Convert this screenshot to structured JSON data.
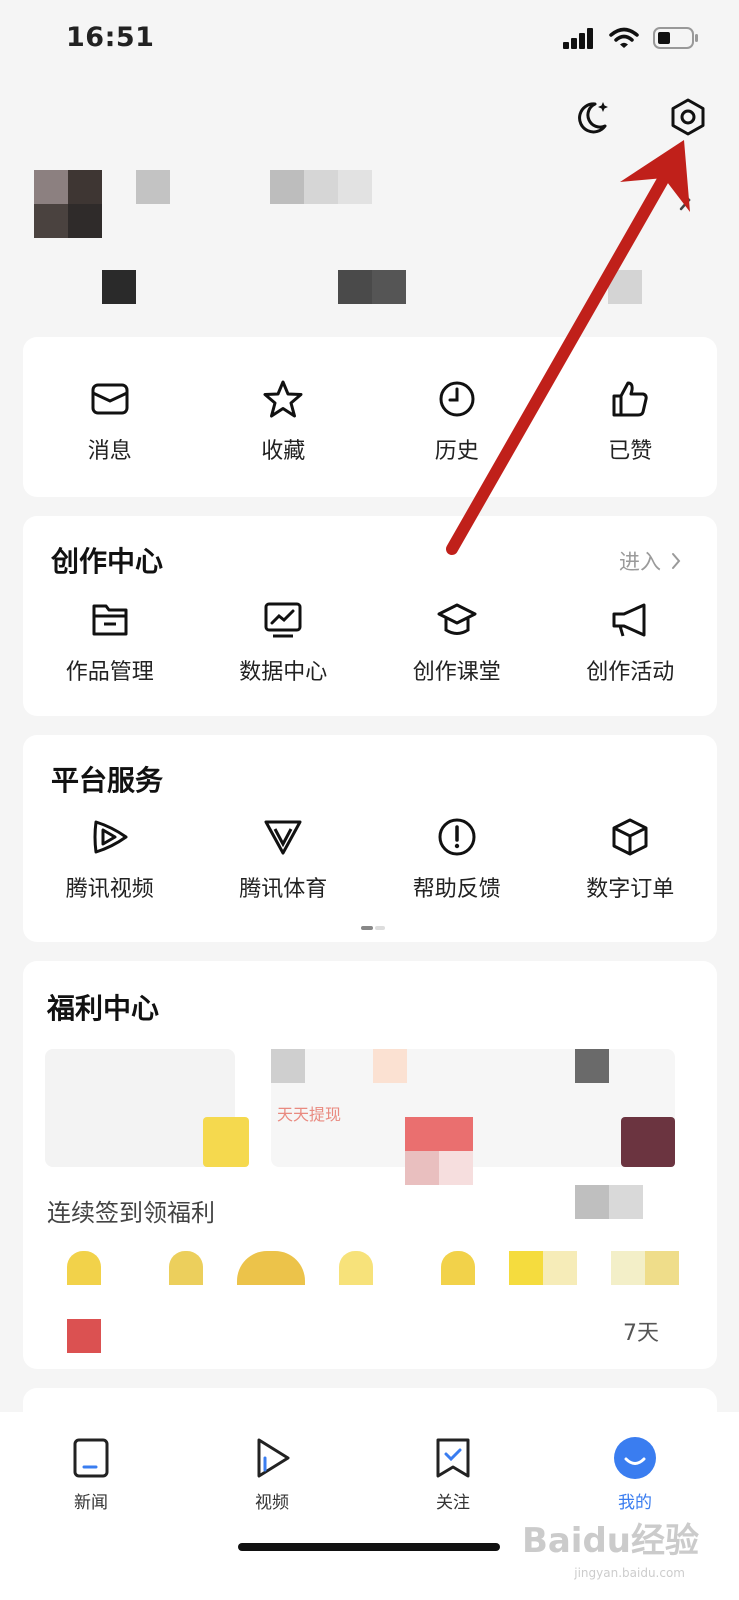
{
  "status_bar": {
    "time": "16:51"
  },
  "top_actions": [
    {
      "name": "night-mode-icon"
    },
    {
      "name": "settings-icon"
    }
  ],
  "quick_actions": [
    {
      "label": "消息",
      "icon": "message-icon"
    },
    {
      "label": "收藏",
      "icon": "star-icon"
    },
    {
      "label": "历史",
      "icon": "clock-icon"
    },
    {
      "label": "已赞",
      "icon": "thumbs-up-icon"
    }
  ],
  "creation_center": {
    "title": "创作中心",
    "enter_label": "进入",
    "items": [
      {
        "label": "作品管理",
        "icon": "folder-icon"
      },
      {
        "label": "数据中心",
        "icon": "chart-icon"
      },
      {
        "label": "创作课堂",
        "icon": "graduation-cap-icon"
      },
      {
        "label": "创作活动",
        "icon": "megaphone-icon"
      }
    ]
  },
  "platform_services": {
    "title": "平台服务",
    "items": [
      {
        "label": "腾讯视频",
        "icon": "tencent-video-icon"
      },
      {
        "label": "腾讯体育",
        "icon": "tencent-sports-icon"
      },
      {
        "label": "帮助反馈",
        "icon": "help-icon"
      },
      {
        "label": "数字订单",
        "icon": "box-icon"
      }
    ]
  },
  "welfare_center": {
    "title": "福利中心",
    "promo_text": "天天提现",
    "signin_title": "连续签到领福利",
    "day_label": "7天"
  },
  "tabbar": [
    {
      "label": "新闻",
      "icon": "news-icon",
      "active": false
    },
    {
      "label": "视频",
      "icon": "video-play-icon",
      "active": false
    },
    {
      "label": "关注",
      "icon": "follow-icon",
      "active": false
    },
    {
      "label": "我的",
      "icon": "me-icon",
      "active": true
    }
  ],
  "colors": {
    "accent": "#3a7df0",
    "arrow": "#c0201a"
  },
  "watermark": {
    "text": "Baidu经验",
    "sub": "jingyan.baidu.com"
  }
}
